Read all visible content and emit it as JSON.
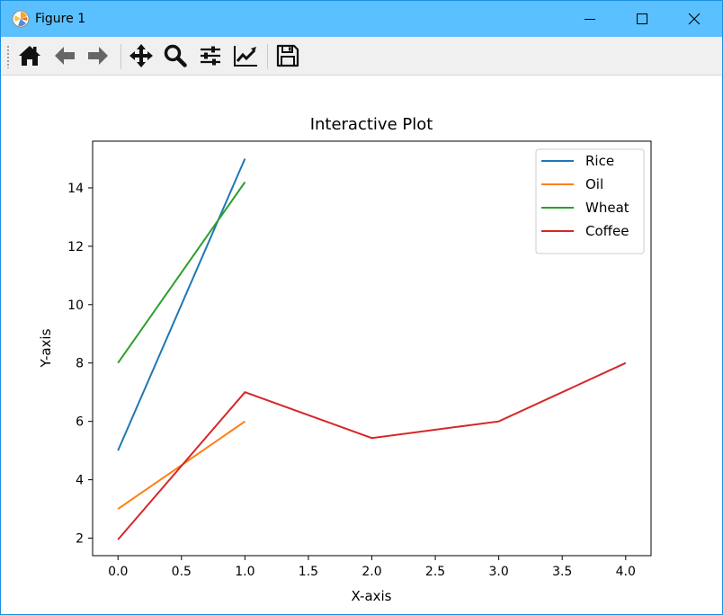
{
  "window": {
    "title": "Figure 1",
    "accent_color": "#5bc0ff",
    "controls": [
      "minimize-icon",
      "maximize-icon",
      "close-icon"
    ]
  },
  "toolbar": {
    "buttons": [
      "home-icon",
      "back-arrow-icon",
      "forward-arrow-icon",
      "pan-move-icon",
      "zoom-magnifier-icon",
      "configure-subplots-icon",
      "edit-axis-lines-icon",
      "save-floppy-icon"
    ]
  },
  "chart_data": {
    "type": "line",
    "title": "Interactive Plot",
    "xlabel": "X-axis",
    "ylabel": "Y-axis",
    "xlim": [
      -0.2,
      4.2
    ],
    "ylim": [
      1.4,
      15.6
    ],
    "xticks": [
      "0.0",
      "0.5",
      "1.0",
      "1.5",
      "2.0",
      "2.5",
      "3.0",
      "3.5",
      "4.0"
    ],
    "xtick_values": [
      0,
      0.5,
      1,
      1.5,
      2,
      2.5,
      3,
      3.5,
      4
    ],
    "yticks": [
      "2",
      "4",
      "6",
      "8",
      "10",
      "12",
      "14"
    ],
    "ytick_values": [
      2,
      4,
      6,
      8,
      10,
      12,
      14
    ],
    "grid": false,
    "legend_position": "top-right",
    "series": [
      {
        "name": "Rice",
        "color": "#1f77b4",
        "x": [
          0,
          1
        ],
        "y": [
          5,
          15
        ]
      },
      {
        "name": "Oil",
        "color": "#ff7f0e",
        "x": [
          0,
          1
        ],
        "y": [
          3,
          6
        ]
      },
      {
        "name": "Wheat",
        "color": "#2ca02c",
        "x": [
          0,
          1
        ],
        "y": [
          8,
          14.2
        ]
      },
      {
        "name": "Coffee",
        "color": "#d62728",
        "x": [
          0,
          1,
          2,
          3,
          4
        ],
        "y": [
          1.95,
          7,
          5.43,
          6,
          8
        ]
      }
    ]
  }
}
